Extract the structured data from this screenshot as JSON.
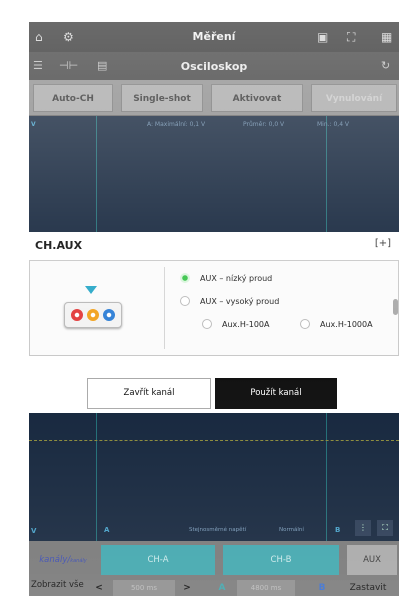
{
  "app": {
    "title": "Měření",
    "subtitle": "Osciloskop"
  },
  "modes": [
    "Auto-CH",
    "Single-shot",
    "Aktivovat",
    "Vynulování"
  ],
  "scope_top": {
    "left_unit": "V",
    "info": [
      "A: Maximální: 0,1 V",
      "Průměr: 0,0 V",
      "Min.: 0,4 V"
    ]
  },
  "dialog": {
    "title": "CH.AUX",
    "options": [
      {
        "label": "AUX – nízký proud",
        "selected": true
      },
      {
        "label": "AUX – vysoký proud",
        "selected": false
      },
      {
        "label": "Aux.H-100A",
        "selected": false
      },
      {
        "label": "Aux.H-1000A",
        "selected": false
      }
    ],
    "close_label": "Zavřít kanál",
    "apply_label": "Použít kanál",
    "jack_colors": [
      "#e23c3c",
      "#f2a21e",
      "#2f7fd6"
    ]
  },
  "scope_bottom": {
    "left_unit": "V",
    "marker_a": "A",
    "marker_b": "B",
    "status_left": "Stejnosměrné napětí",
    "status_right": "Normální"
  },
  "channels": {
    "left_label": "kanály/",
    "left_sub": "kanály",
    "cha": "CH-A",
    "chb": "CH-B",
    "aux": "AUX"
  },
  "bottom": {
    "show_all": "Zobrazit vše",
    "prev": "<",
    "time_a": "500 ms",
    "next": ">",
    "a": "A",
    "val_a": "4800 ms",
    "b": "B",
    "stop": "Zastavit"
  },
  "colors": {
    "scope_bg": "#14253c",
    "channel_teal": "#3fa6ad",
    "apply_bg": "#111111"
  }
}
